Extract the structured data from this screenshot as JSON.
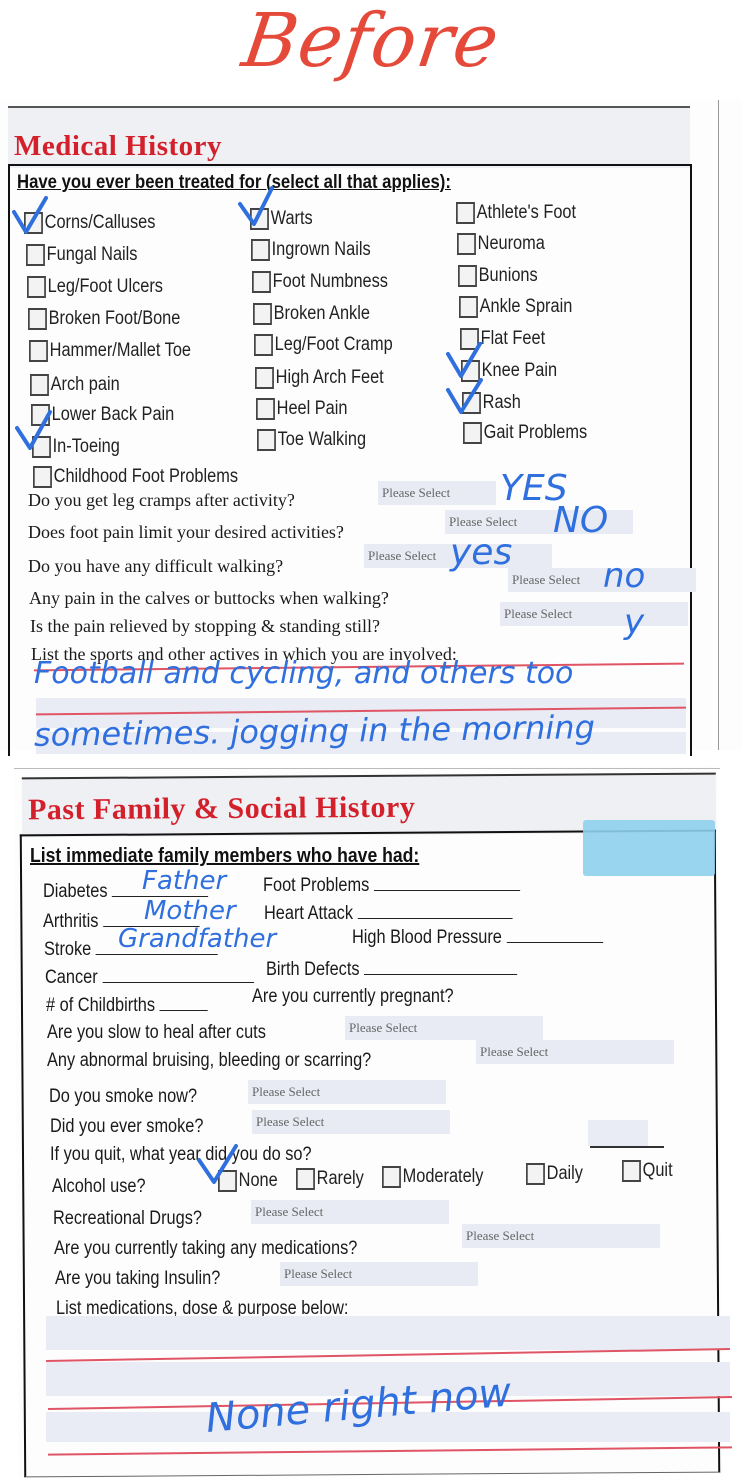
{
  "header": {
    "title": "Before",
    "title_color": "#e4493a"
  },
  "ink_color": "#2f6fde",
  "medical_history": {
    "title": "Medical History",
    "title_color": "#d3202b",
    "prompt": "Have you ever been treated for (select all that applies):",
    "conditions": [
      {
        "label": "Corns/Calluses",
        "checked": true
      },
      {
        "label": "Fungal Nails",
        "checked": false
      },
      {
        "label": "Leg/Foot Ulcers",
        "checked": false
      },
      {
        "label": "Broken Foot/Bone",
        "checked": false
      },
      {
        "label": "Hammer/Mallet Toe",
        "checked": false
      },
      {
        "label": "Arch pain",
        "checked": false
      },
      {
        "label": "Lower Back Pain",
        "checked": false
      },
      {
        "label": "In-Toeing",
        "checked": true
      },
      {
        "label": "Childhood Foot Problems",
        "checked": false
      },
      {
        "label": "Warts",
        "checked": true
      },
      {
        "label": "Ingrown Nails",
        "checked": false
      },
      {
        "label": "Foot Numbness",
        "checked": false
      },
      {
        "label": "Broken Ankle",
        "checked": false
      },
      {
        "label": "Leg/Foot Cramp",
        "checked": false
      },
      {
        "label": "High Arch Feet",
        "checked": false
      },
      {
        "label": "Heel Pain",
        "checked": false
      },
      {
        "label": "Toe Walking",
        "checked": false
      },
      {
        "label": "Athlete's Foot",
        "checked": false
      },
      {
        "label": "Neuroma",
        "checked": false
      },
      {
        "label": "Bunions",
        "checked": false
      },
      {
        "label": "Ankle Sprain",
        "checked": false
      },
      {
        "label": "Flat Feet",
        "checked": false
      },
      {
        "label": "Knee Pain",
        "checked": true
      },
      {
        "label": "Rash",
        "checked": true
      },
      {
        "label": "Gait Problems",
        "checked": false
      }
    ],
    "questions": [
      {
        "label": "Do you get leg cramps after activity?",
        "select": "Please Select",
        "answer": "YES"
      },
      {
        "label": "Does foot pain limit your desired activities?",
        "select": "Please Select",
        "answer": "NO"
      },
      {
        "label": "Do you have any difficult walking?",
        "select": "Please Select",
        "answer": "yes"
      },
      {
        "label": "Any pain in the calves or buttocks when walking?",
        "select": "Please Select",
        "answer": "no"
      },
      {
        "label": "Is the pain relieved by stopping & standing still?",
        "select": "Please Select",
        "answer": "y"
      }
    ],
    "sports_prompt": "List the sports and other actives in which you are involved:",
    "sports_answer_line1": "Football and cycling, and others too",
    "sports_answer_line2": "sometimes. jogging in the morning"
  },
  "family_history": {
    "title": "Past Family & Social History",
    "prompt": "List immediate family members who have had:",
    "diseases": [
      {
        "label": "Diabetes",
        "value": "Father"
      },
      {
        "label": "Foot Problems",
        "value": ""
      },
      {
        "label": "Arthritis",
        "value": "Mother"
      },
      {
        "label": "Heart Attack",
        "value": ""
      },
      {
        "label": "Stroke",
        "value": "Grandfather"
      },
      {
        "label": "High Blood Pressure",
        "value": ""
      },
      {
        "label": "Cancer",
        "value": ""
      },
      {
        "label": "Birth Defects",
        "value": ""
      }
    ],
    "childbirths_label": "# of Childbirths",
    "pregnant_label": "Are you currently pregnant?",
    "questions": [
      {
        "label": "Are you slow to heal after cuts",
        "select": "Please Select"
      },
      {
        "label": "Any abnormal bruising, bleeding or scarring?",
        "select": "Please Select"
      },
      {
        "label": "Do you smoke now?",
        "select": "Please Select"
      },
      {
        "label": "Did you ever smoke?",
        "select": "Please Select"
      }
    ],
    "quit_year_label": "If you quit,  what year did you do so?",
    "alcohol": {
      "label": "Alcohol use?",
      "options": [
        {
          "label": "None",
          "checked": true
        },
        {
          "label": "Rarely",
          "checked": false
        },
        {
          "label": "Moderately",
          "checked": false
        },
        {
          "label": "Daily",
          "checked": false
        },
        {
          "label": "Quit",
          "checked": false
        }
      ]
    },
    "questions2": [
      {
        "label": "Recreational Drugs?",
        "select": "Please Select"
      },
      {
        "label": "Are you currently taking any medications?",
        "select": "Please Select"
      },
      {
        "label": "Are you taking Insulin?",
        "select": "Please Select"
      }
    ],
    "medications_prompt": "List medications, dose & purpose below:",
    "medications_answer": "None right now"
  }
}
